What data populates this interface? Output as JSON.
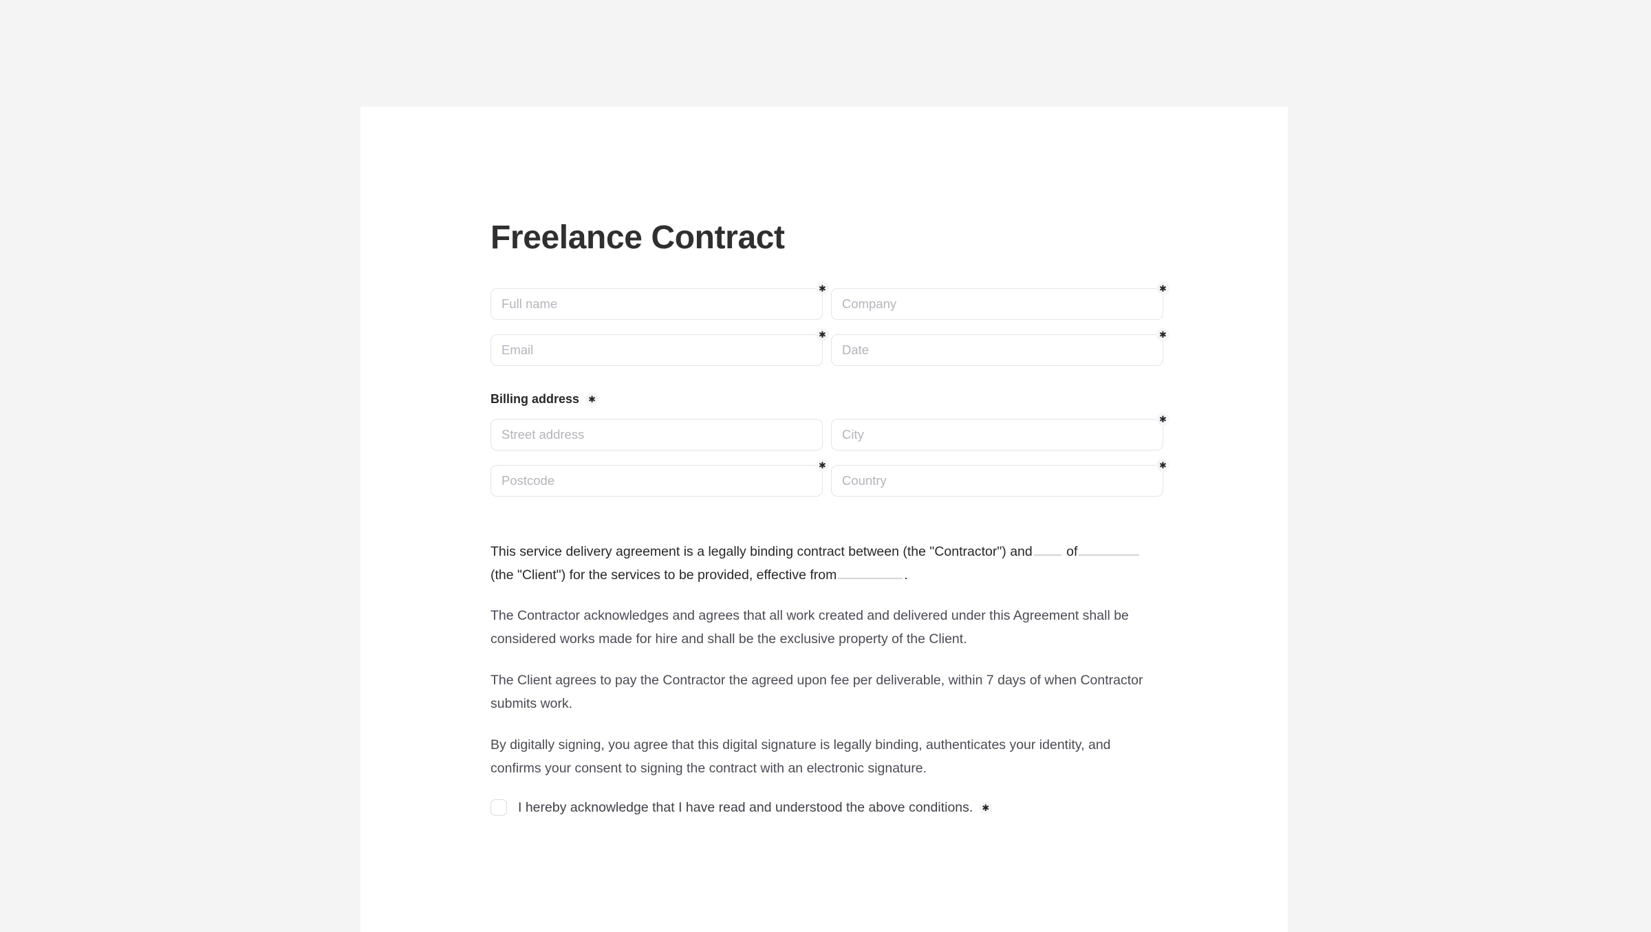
{
  "document": {
    "title": "Freelance Contract",
    "required_marker": "✱"
  },
  "form": {
    "fields": [
      {
        "name": "full-name",
        "placeholder": "Full name",
        "value": "",
        "required": true,
        "column": "left"
      },
      {
        "name": "company",
        "placeholder": "Company",
        "value": "",
        "required": true,
        "column": "right"
      },
      {
        "name": "email",
        "placeholder": "Email",
        "value": "",
        "required": true,
        "column": "left"
      },
      {
        "name": "date",
        "placeholder": "Date",
        "value": "",
        "required": true,
        "column": "right"
      },
      {
        "name": "street-address",
        "placeholder": "Street address",
        "value": "",
        "required": false,
        "column": "left"
      },
      {
        "name": "city",
        "placeholder": "City",
        "value": "",
        "required": true,
        "column": "right"
      },
      {
        "name": "postcode",
        "placeholder": "Postcode",
        "value": "",
        "required": true,
        "column": "left"
      },
      {
        "name": "country",
        "placeholder": "Country",
        "value": "",
        "required": true,
        "column": "right"
      }
    ],
    "billing_section_label": "Billing address"
  },
  "contract": {
    "paragraph_1": {
      "part_1": "This service delivery agreement is a legally binding contract between (the \"Contractor\") and",
      "part_2": "of",
      "part_3": "(the \"Client\") for the services to be provided, effective from",
      "part_4": "."
    },
    "paragraph_2": "The Contractor acknowledges and agrees that all work created and delivered under this Agreement shall be considered works made for hire and shall be the exclusive property of the Client.",
    "paragraph_3": "The Client agrees to pay the Contractor the agreed upon fee per deliverable, within 7 days of when Contractor submits work.",
    "paragraph_4": "By digitally signing, you agree that this digital signature is legally binding, authenticates your identity, and confirms your consent to signing the contract with an electronic signature."
  },
  "consent": {
    "label": "I hereby acknowledge that I have read and understood the above conditions.",
    "checked": false,
    "required_marker": "✱"
  },
  "colors": {
    "page_background": "#f4f4f5",
    "card_background": "#ffffff",
    "title_text": "#2f2f2f",
    "body_text": "#4b4b53",
    "lead_text": "#27272a",
    "field_border": "#e4e4e7",
    "placeholder_text": "#b4b4bb",
    "blank_underline": "#d4d4d8",
    "badge_background": "#f6f6f7"
  }
}
